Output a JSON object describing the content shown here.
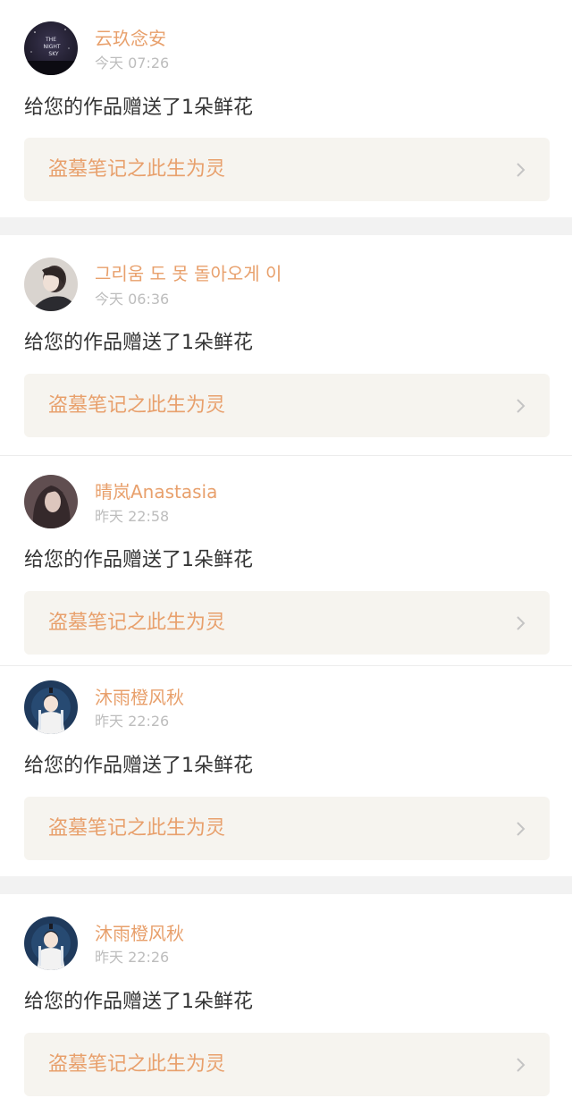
{
  "colors": {
    "accent": "#e8a06c",
    "message_text": "#333333",
    "timestamp": "#bdbdbd",
    "link_background": "#f6f4ef",
    "page_background": "#f2f2f2"
  },
  "notifications": [
    {
      "user": "云玖念安",
      "time": "今天 07:26",
      "message": "给您的作品赠送了1朵鲜花",
      "work_title": "盗墓笔记之此生为灵",
      "avatar_icon": "night-sky-avatar",
      "avatar_text": [
        "THE",
        "NIGHT",
        "SKY"
      ]
    },
    {
      "user": "그리움 도 못 돌아오게 이",
      "time": "今天 06:36",
      "message": "给您的作品赠送了1朵鲜花",
      "work_title": "盗墓笔记之此生为灵",
      "avatar_icon": "portrait-avatar"
    },
    {
      "user": "晴岚Anastasia",
      "time": "昨天 22:58",
      "message": "给您的作品赠送了1朵鲜花",
      "work_title": "盗墓笔记之此生为灵",
      "avatar_icon": "portrait-avatar"
    },
    {
      "user": "沐雨橙风秋",
      "time": "昨天 22:26",
      "message": "给您的作品赠送了1朵鲜花",
      "work_title": "盗墓笔记之此生为灵",
      "avatar_icon": "anime-character-avatar"
    },
    {
      "user": "沐雨橙风秋",
      "time": "昨天 22:26",
      "message": "给您的作品赠送了1朵鲜花",
      "work_title": "盗墓笔记之此生为灵",
      "avatar_icon": "anime-character-avatar"
    }
  ]
}
